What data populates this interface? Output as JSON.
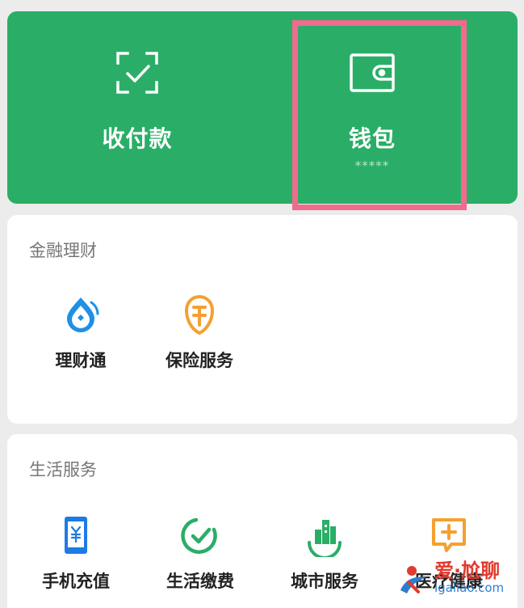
{
  "top": {
    "pay": {
      "label": "收付款",
      "icon": "scan-check-icon"
    },
    "wallet": {
      "label": "钱包",
      "masked_balance": "*****",
      "icon": "wallet-icon"
    }
  },
  "finance": {
    "title": "金融理财",
    "items": [
      {
        "label": "理财通",
        "icon": "wealth-drop-icon",
        "color": "#1e90e6"
      },
      {
        "label": "保险服务",
        "icon": "insurance-shield-icon",
        "color": "#f5a031"
      }
    ]
  },
  "life": {
    "title": "生活服务",
    "items": [
      {
        "label": "手机充值",
        "icon": "phone-yuan-icon",
        "color": "#1e7be6"
      },
      {
        "label": "生活缴费",
        "icon": "payment-check-icon",
        "color": "#2aae67"
      },
      {
        "label": "城市服务",
        "icon": "city-buildings-icon",
        "color": "#2aae67"
      },
      {
        "label": "医疗健康",
        "icon": "medical-plus-icon",
        "color": "#f5a031"
      }
    ]
  },
  "watermark": {
    "cn": "爱·尬聊",
    "en": "igaliao.com"
  },
  "colors": {
    "brand_green": "#2aae67",
    "highlight": "#f06b8e"
  }
}
